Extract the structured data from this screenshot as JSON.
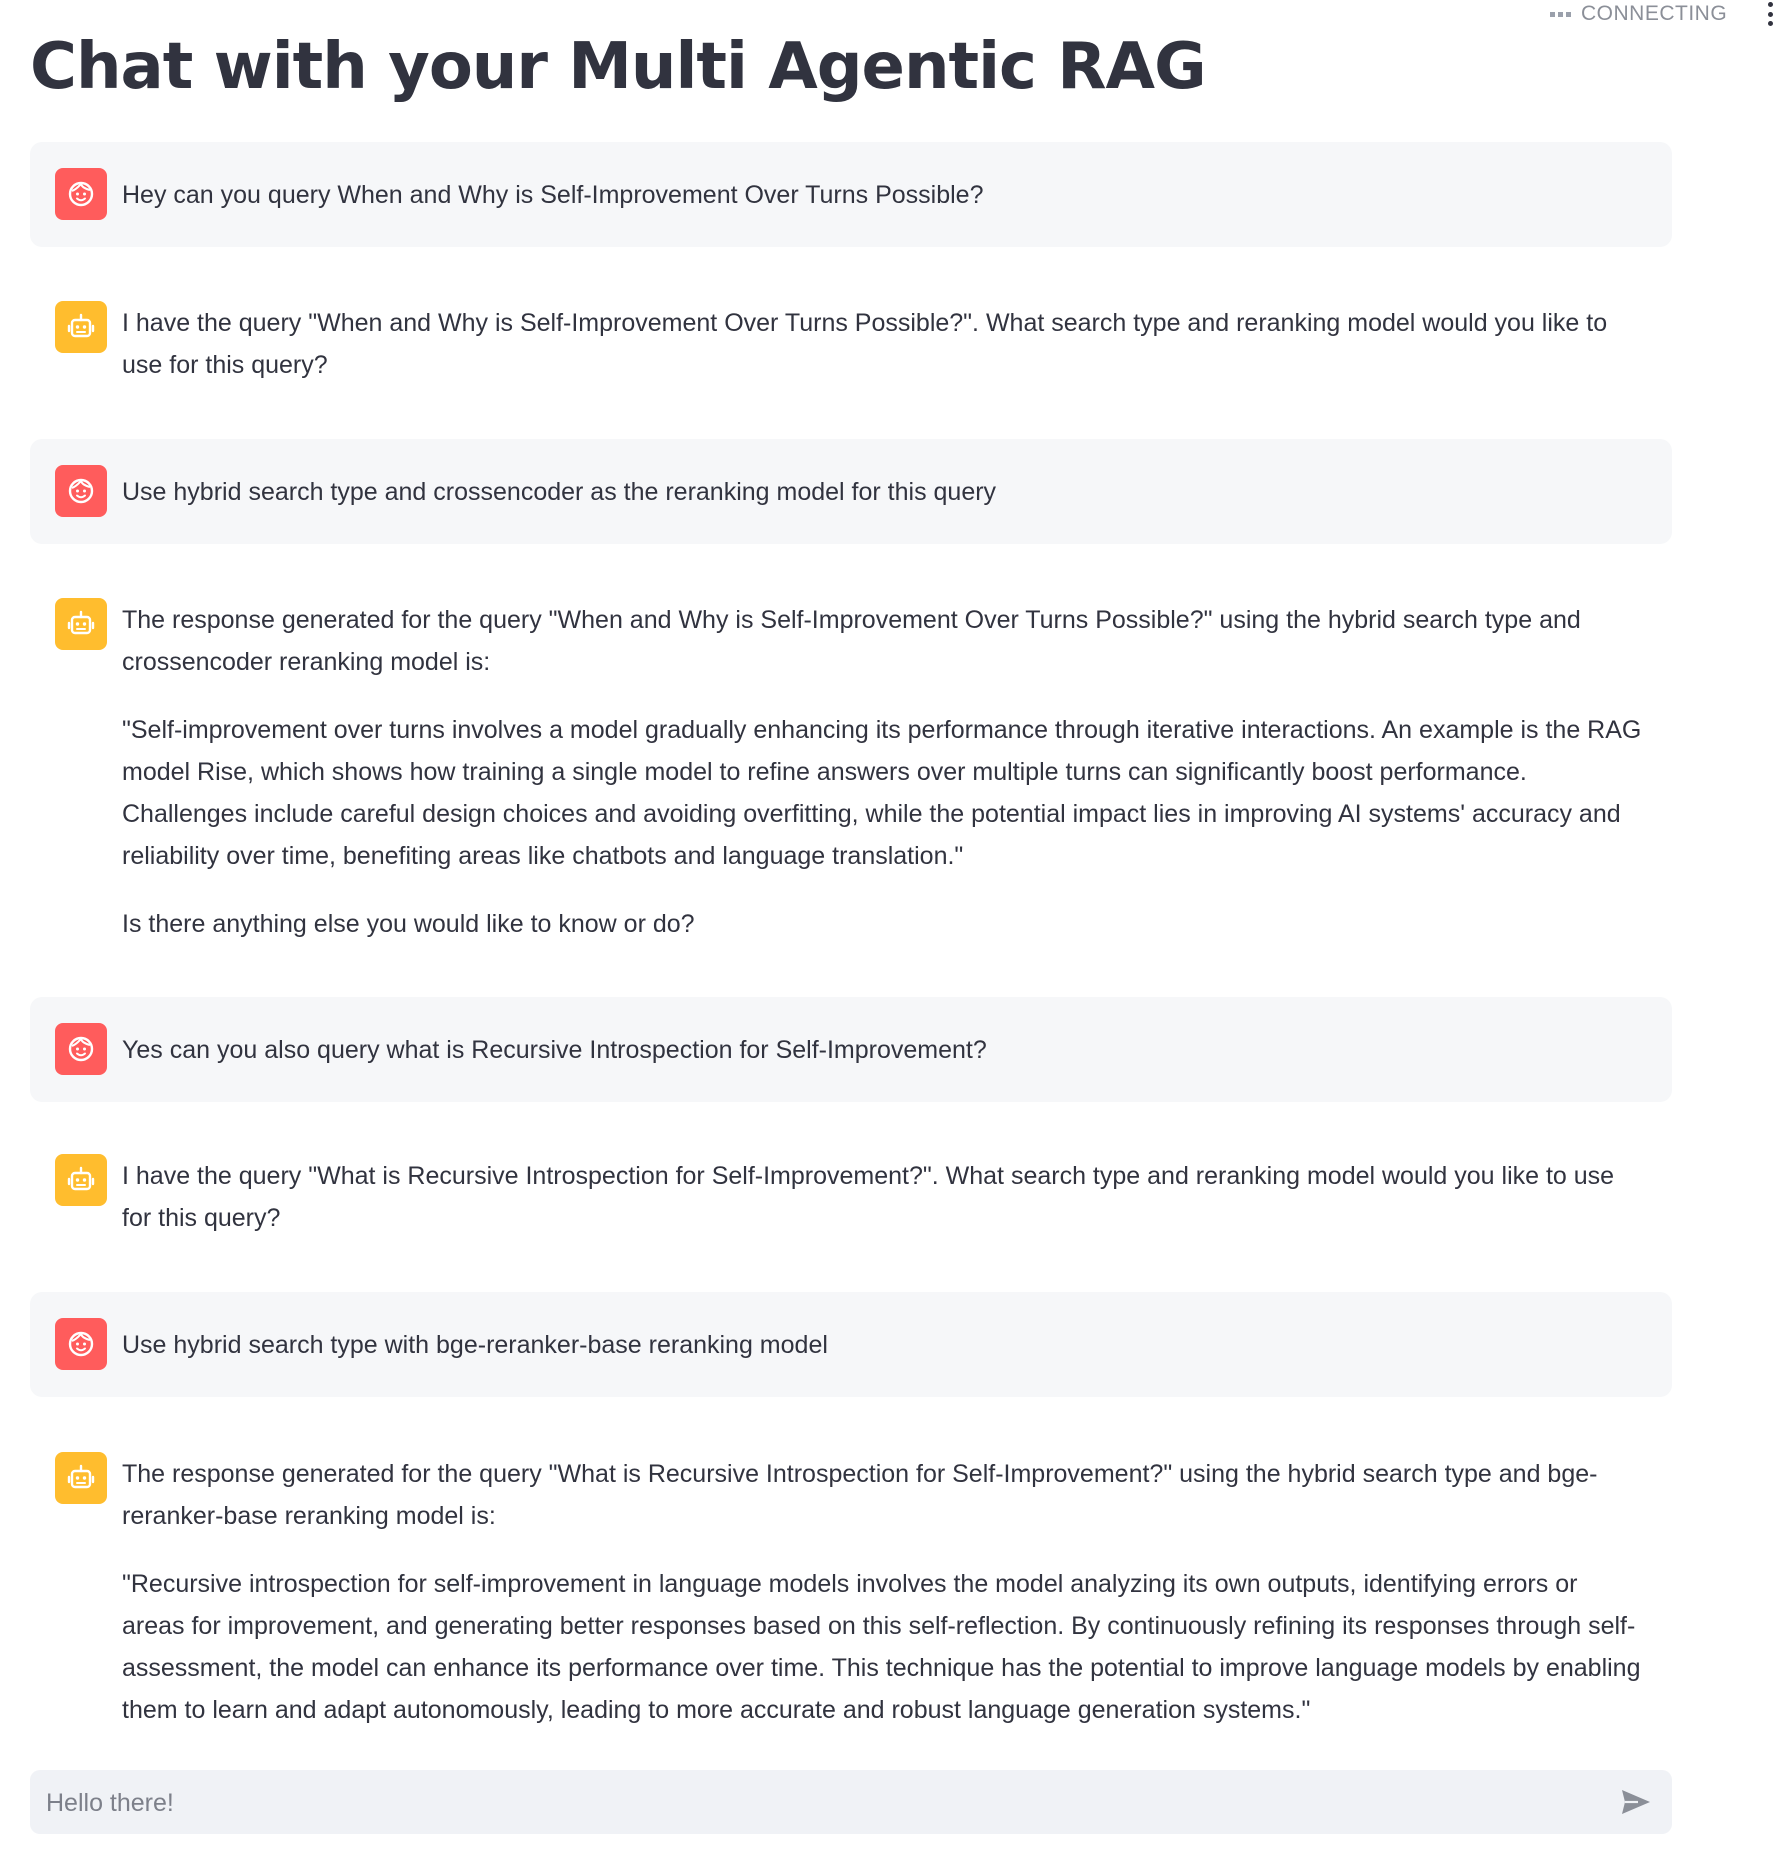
{
  "status": {
    "text": "CONNECTING"
  },
  "header": {
    "title": "Chat with your Multi Agentic RAG"
  },
  "messages": [
    {
      "role": "user",
      "paragraphs": [
        "Hey can you query When and Why is Self-Improvement Over Turns Possible?"
      ]
    },
    {
      "role": "assistant",
      "paragraphs": [
        "I have the query \"When and Why is Self-Improvement Over Turns Possible?\". What search type and reranking model would you like to use for this query?"
      ]
    },
    {
      "role": "user",
      "paragraphs": [
        "Use hybrid search type and crossencoder as the reranking model for this query"
      ]
    },
    {
      "role": "assistant",
      "paragraphs": [
        "The response generated for the query \"When and Why is Self-Improvement Over Turns Possible?\" using the hybrid search type and crossencoder reranking model is:",
        "\"Self-improvement over turns involves a model gradually enhancing its performance through iterative interactions. An example is the RAG model Rise, which shows how training a single model to refine answers over multiple turns can significantly boost performance. Challenges include careful design choices and avoiding overfitting, while the potential impact lies in improving AI systems' accuracy and reliability over time, benefiting areas like chatbots and language translation.\"",
        "Is there anything else you would like to know or do?"
      ]
    },
    {
      "role": "user",
      "paragraphs": [
        "Yes can you also query what is Recursive Introspection for Self-Improvement?"
      ]
    },
    {
      "role": "assistant",
      "paragraphs": [
        "I have the query \"What is Recursive Introspection for Self-Improvement?\". What search type and reranking model would you like to use for this query?"
      ]
    },
    {
      "role": "user",
      "paragraphs": [
        "Use hybrid search type with bge-reranker-base reranking model"
      ]
    },
    {
      "role": "assistant",
      "paragraphs": [
        "The response generated for the query \"What is Recursive Introspection for Self-Improvement?\" using the hybrid search type and bge-reranker-base reranking model is:",
        "\"Recursive introspection for self-improvement in language models involves the model analyzing its own outputs, identifying errors or areas for improvement, and generating better responses based on this self-reflection. By continuously refining its responses through self-assessment, the model can enhance its performance over time. This technique has the potential to improve language models by enabling them to learn and adapt autonomously, leading to more accurate and robust language generation systems.\""
      ]
    }
  ],
  "input": {
    "placeholder": "Hello there!",
    "value": ""
  },
  "icons": {
    "user_avatar": "smiley-face-icon",
    "assistant_avatar": "robot-icon",
    "send": "send-arrow-icon",
    "menu": "kebab-menu-icon",
    "status": "connecting-dots-icon"
  },
  "colors": {
    "user_avatar_bg": "#ff5c5c",
    "assistant_avatar_bg": "#ffbd2e",
    "user_message_bg": "#f6f7f9",
    "input_bg": "#f0f2f6",
    "text": "#31333f"
  }
}
